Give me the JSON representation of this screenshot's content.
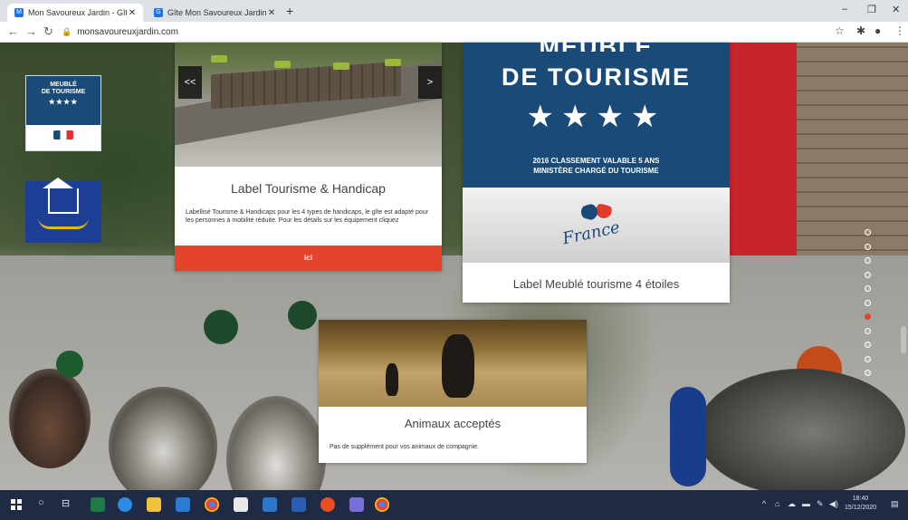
{
  "browser": {
    "tabs": [
      {
        "title": "Mon Savoureux Jardin - Gîte en",
        "close": "✕"
      },
      {
        "title": "Gîte Mon Savoureux Jardin - Ch",
        "close": "✕"
      }
    ],
    "new_tab": "+",
    "url": "monsavoureuxjardin.com",
    "window_controls": {
      "minimize": "–",
      "restore": "❐",
      "close": "✕"
    }
  },
  "badges": {
    "meuble": {
      "line1": "MEUBLÉ",
      "line2": "DE TOURISME",
      "stars": "★★★★"
    },
    "handicap": {}
  },
  "cards": {
    "handicap": {
      "prev": "<<",
      "next": ">",
      "title": "Label Tourisme & Handicap",
      "text": "Labellisé Tourisme & Handicaps pour les 4 types de handicaps, le gîte est adapté pour les personnes à mobilité réduite. Pour les détails sur les équipement cliquez",
      "cta": "ici"
    },
    "meuble": {
      "heading1": "MEUBLÉ",
      "heading2": "DE TOURISME",
      "stars": "★★★★",
      "sub1": "2016 CLASSEMENT VALABLE 5 ANS",
      "sub2": "MINISTÈRE CHARGÉ DU TOURISME",
      "france": "France",
      "title": "Label Meublé tourisme 4 étoiles"
    },
    "animaux": {
      "title": "Animaux acceptés",
      "text": "Pas de supplément pour vos animaux de compagnie."
    }
  },
  "slides": {
    "count": 11,
    "active_index": 6
  },
  "taskbar": {
    "time": "18:40",
    "date": "15/12/2020"
  },
  "colors": {
    "accent": "#e4432c",
    "label_blue": "#1a4a78",
    "taskbar": "#1f2a44"
  }
}
